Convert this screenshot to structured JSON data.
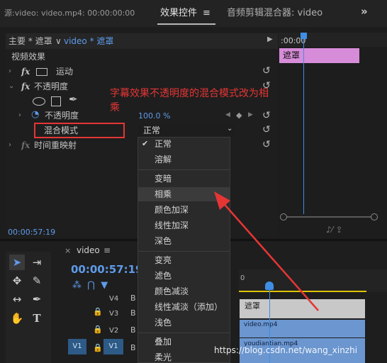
{
  "tabs": {
    "source": "源:video: video.mp4: 00:00:00:00",
    "effect_controls": "效果控件",
    "effect_controls_menu": "≡",
    "audio_mixer": "音频剪辑混合器: video",
    "more": "»"
  },
  "effect_controls": {
    "clip_master": "主要 * 遮罩",
    "clip_separator": "∨",
    "clip_active": "video * 遮罩",
    "section_video_effects": "视频效果",
    "motion_label": "运动",
    "opacity_label": "不透明度",
    "opacity_property_label": "不透明度",
    "opacity_value": "100.0 %",
    "blend_mode_label": "混合模式",
    "blend_mode_value": "正常",
    "time_remap_label": "时间重映射",
    "fx_glyph": "fx",
    "timecode": "00:00:57:19",
    "mini_timeline_time": ":00:00",
    "mini_timeline_clip": "遮罩"
  },
  "annotation": "字幕效果不透明度的混合模式改为相乘",
  "blend_menu": {
    "selected": "正常",
    "hovered": "相乘",
    "items": [
      "正常",
      "溶解",
      "变暗",
      "相乘",
      "颜色加深",
      "线性加深",
      "深色",
      "变亮",
      "滤色",
      "颜色减淡",
      "线性减淡（添加）",
      "浅色",
      "叠加",
      "柔光"
    ]
  },
  "timeline": {
    "name": "video",
    "menu": "≡",
    "close": "×",
    "timecode": "00:00:57:19",
    "ruler_label": "0",
    "tracks": [
      {
        "name": "V4",
        "toggle": "B"
      },
      {
        "name": "V3",
        "toggle": "B"
      },
      {
        "name": "V2",
        "toggle": "B"
      },
      {
        "name": "V1",
        "toggle": "B",
        "source": "V1"
      }
    ],
    "clips": {
      "title_clip": "遮罩",
      "v2_clip": "video.mp4",
      "v1_clip": "youdiantian.mp4"
    }
  },
  "watermark": "https://blog.csdn.net/wang_xinzhi",
  "colors": {
    "accent_blue": "#5e9bea",
    "annotation_red": "#e53535",
    "mask_clip_pink": "#d78cd9",
    "video_clip_blue": "#6b96cf",
    "work_area_yellow": "#e0c400"
  }
}
